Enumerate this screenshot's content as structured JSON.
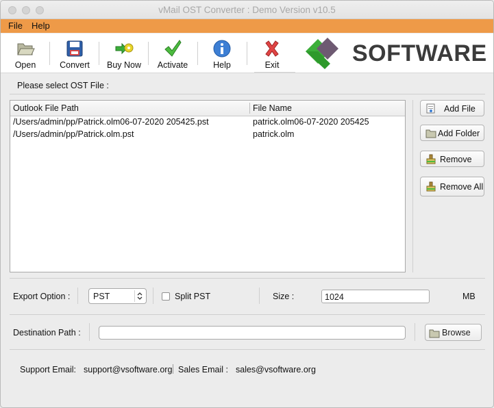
{
  "window": {
    "title": "vMail OST Converter : Demo Version v10.5"
  },
  "menu": {
    "file": "File",
    "help": "Help"
  },
  "toolbar": {
    "open": "Open",
    "convert": "Convert",
    "buy_now": "Buy Now",
    "activate": "Activate",
    "help": "Help",
    "exit": "Exit"
  },
  "logo": {
    "text": "SOFTWARE"
  },
  "file_section": {
    "label": "Please select OST File :",
    "columns": [
      "Outlook File Path",
      "File Name"
    ],
    "rows": [
      {
        "path": "/Users/admin/pp/Patrick.olm06-07-2020 205425.pst",
        "name": "patrick.olm06-07-2020 205425"
      },
      {
        "path": "/Users/admin/pp/Patrick.olm.pst",
        "name": "patrick.olm"
      }
    ]
  },
  "side_buttons": {
    "add_file": "Add File",
    "add_folder": "Add Folder",
    "remove": "Remove",
    "remove_all": "Remove All"
  },
  "export": {
    "label": "Export Option :",
    "selected": "PST",
    "split_label": "Split PST",
    "split_checked": false,
    "size_label": "Size :",
    "size_value": "1024",
    "size_unit": "MB"
  },
  "destination": {
    "label": "Destination Path :",
    "value": "",
    "browse": "Browse"
  },
  "footer": {
    "support_label": "Support Email:",
    "support_email": "support@vsoftware.org",
    "sales_label": "Sales Email :",
    "sales_email": "sales@vsoftware.org"
  },
  "colors": {
    "menubar": "#ee9a48",
    "logo_green": "#3cae3a",
    "logo_purple": "#6e5a72"
  }
}
